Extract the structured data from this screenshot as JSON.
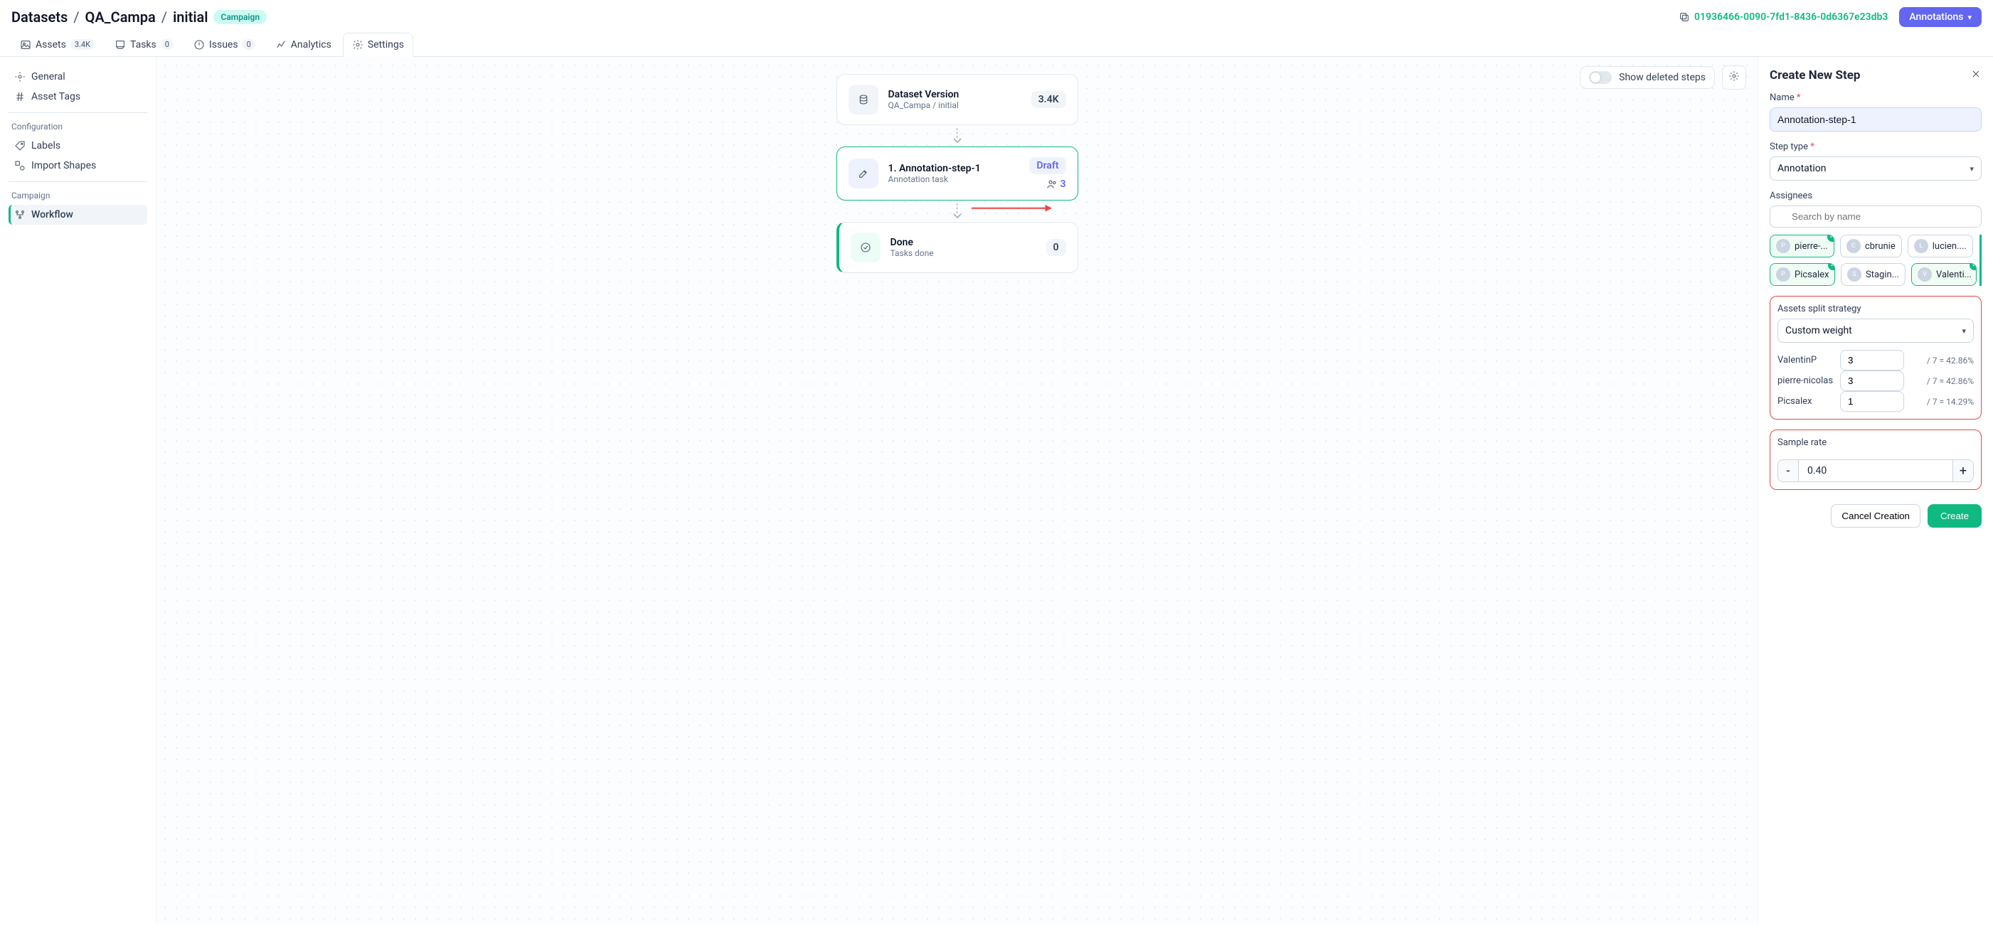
{
  "breadcrumb": {
    "root": "Datasets",
    "dataset": "QA_Campa",
    "version": "initial",
    "badge": "Campaign"
  },
  "uuid": "01936466-0090-7fd1-8436-0d6367e23db3",
  "annotations_btn": "Annotations",
  "tabs": {
    "assets": {
      "label": "Assets",
      "count": "3.4K"
    },
    "tasks": {
      "label": "Tasks",
      "count": "0"
    },
    "issues": {
      "label": "Issues",
      "count": "0"
    },
    "analytics": {
      "label": "Analytics"
    },
    "settings": {
      "label": "Settings"
    }
  },
  "sidenav": {
    "general": "General",
    "asset_tags": "Asset Tags",
    "section_conf": "Configuration",
    "labels": "Labels",
    "import_shapes": "Import Shapes",
    "section_camp": "Campaign",
    "workflow": "Workflow"
  },
  "canvas": {
    "toggle_label": "Show deleted steps",
    "nodes": {
      "dataset": {
        "title": "Dataset Version",
        "sub": "QA_Campa / initial",
        "count": "3.4K"
      },
      "step": {
        "title": "1. Annotation-step-1",
        "sub": "Annotation task",
        "status": "Draft",
        "assignees": "3"
      },
      "done": {
        "title": "Done",
        "sub": "Tasks done",
        "count": "0"
      }
    }
  },
  "panel": {
    "title": "Create New Step",
    "name_label": "Name",
    "name_value": "Annotation-step-1",
    "type_label": "Step type",
    "type_value": "Annotation",
    "assignees_label": "Assignees",
    "search_placeholder": "Search by name",
    "chips": [
      {
        "label": "pierre-...",
        "selected": true
      },
      {
        "label": "cbrunie",
        "selected": false
      },
      {
        "label": "lucien....",
        "selected": false
      },
      {
        "label": "Picsalex",
        "selected": true
      },
      {
        "label": "Stagin...",
        "selected": false
      },
      {
        "label": "Valenti...",
        "selected": true
      }
    ],
    "split_label": "Assets split strategy",
    "split_value": "Custom weight",
    "weights": [
      {
        "name": "ValentinP",
        "value": "3",
        "frac": "/ 7 = 42.86%"
      },
      {
        "name": "pierre-nicolas",
        "value": "3",
        "frac": "/ 7 = 42.86%"
      },
      {
        "name": "Picsalex",
        "value": "1",
        "frac": "/ 7 = 14.29%"
      }
    ],
    "sample_label": "Sample rate",
    "sample_value": "0.40",
    "cancel": "Cancel Creation",
    "create": "Create"
  }
}
